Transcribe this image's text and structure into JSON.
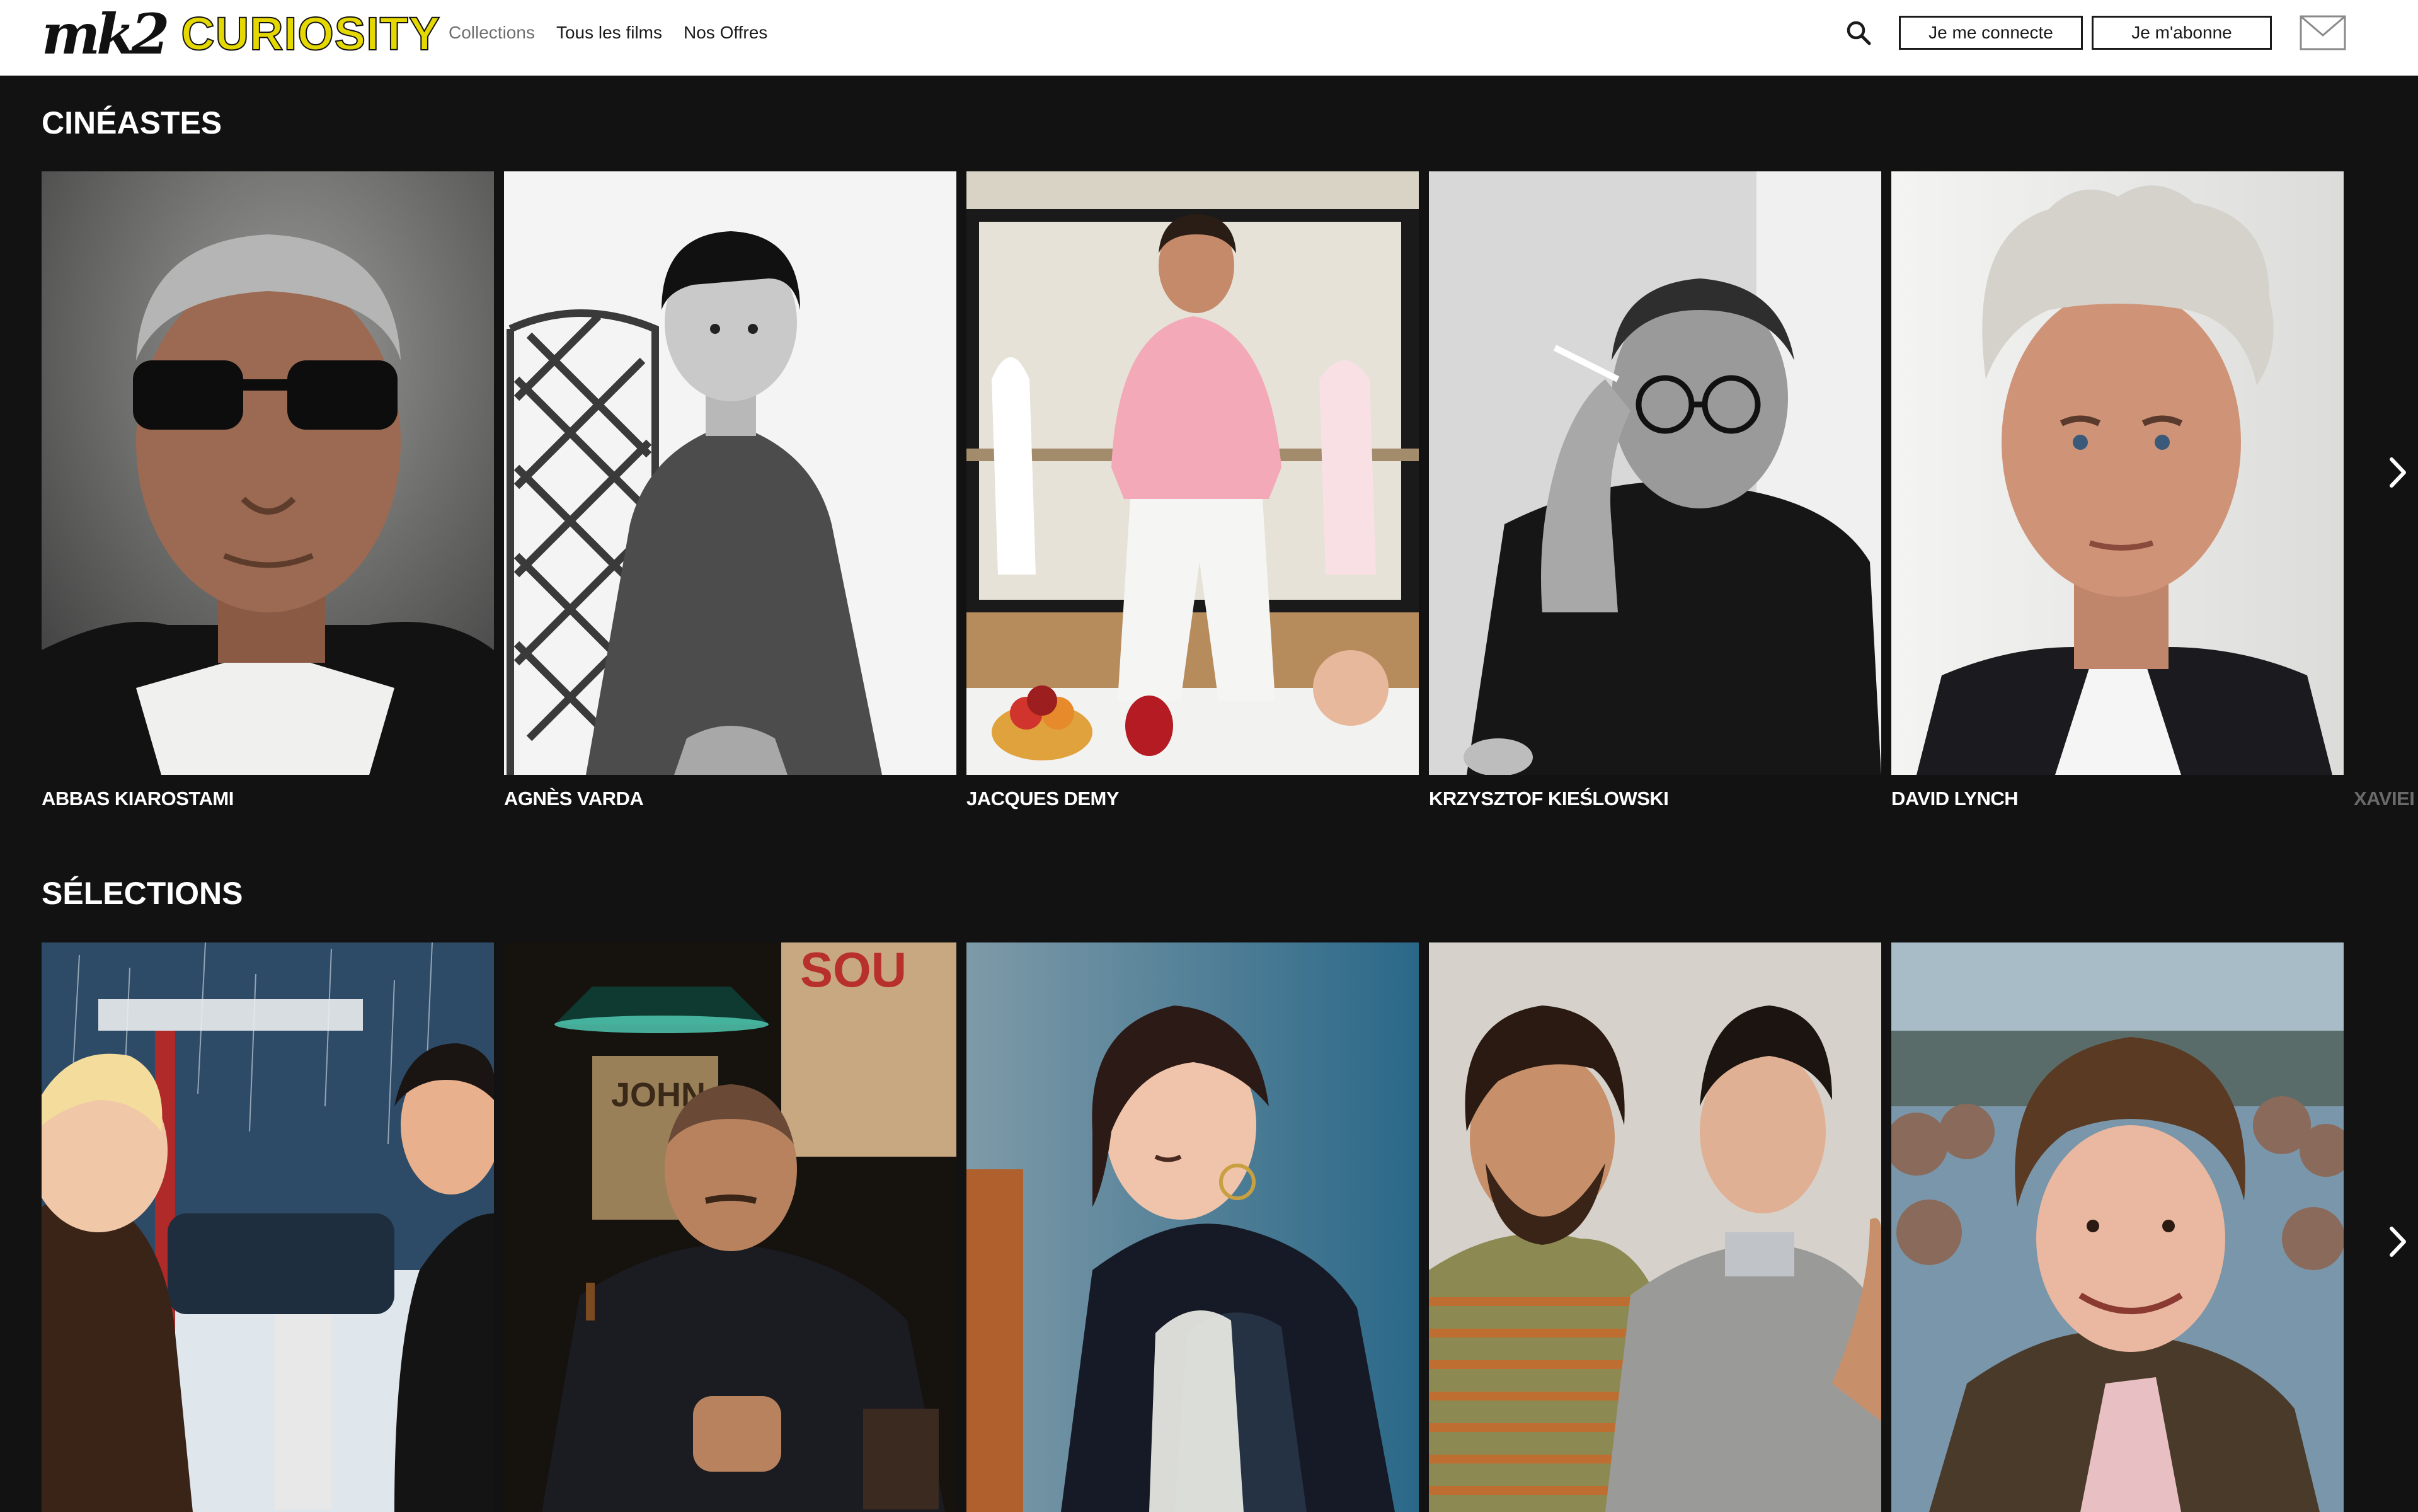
{
  "header": {
    "logo_mk2": "mk2",
    "logo_curiosity": "CURIOSITY",
    "nav": [
      {
        "label": "Collections"
      },
      {
        "label": "Tous les films"
      },
      {
        "label": "Nos Offres"
      }
    ],
    "login_label": "Je me connecte",
    "subscribe_label": "Je m'abonne",
    "icons": {
      "search": "search-icon",
      "mail": "mail-icon"
    }
  },
  "cineastes": {
    "title": "CINÉASTES",
    "items": [
      {
        "name": "ABBAS KIAROSTAMI"
      },
      {
        "name": "AGNÈS VARDA"
      },
      {
        "name": "JACQUES DEMY"
      },
      {
        "name": "KRZYSZTOF KIEŚLOWSKI"
      },
      {
        "name": "DAVID LYNCH"
      },
      {
        "name": "XAVIEI"
      }
    ]
  },
  "selections": {
    "title": "SÉLECTIONS",
    "items": [
      {
        "image": "snowy-street-couple"
      },
      {
        "image": "man-with-cigar"
      },
      {
        "image": "young-woman-earrings"
      },
      {
        "image": "two-bearded-brothers"
      },
      {
        "image": "curly-haired-man-crowd"
      }
    ]
  },
  "colors": {
    "background": "#121212",
    "header_bg": "#ffffff",
    "logo_accent": "#e5d800",
    "text": "#ffffff",
    "peek_text": "#6a6a6a"
  }
}
